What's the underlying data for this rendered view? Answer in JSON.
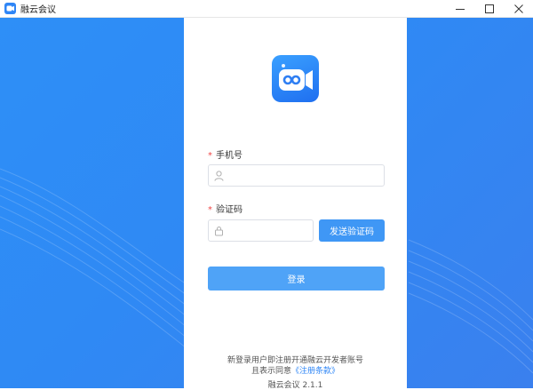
{
  "window": {
    "title": "融云会议",
    "controls": [
      "minimize",
      "maximize",
      "close"
    ]
  },
  "form": {
    "phone_label": "手机号",
    "phone_value": "",
    "phone_placeholder": "",
    "code_label": "验证码",
    "code_value": "",
    "code_placeholder": "",
    "required_mark": "*",
    "send_code_button": "发送验证码",
    "login_button": "登录"
  },
  "footer": {
    "notice_line1": "新登录用户即注册开通融云开发者账号",
    "notice_line2_prefix": "且表示同意",
    "terms_link": "《注册条款》",
    "version": "融云会议 2.1.1"
  },
  "colors": {
    "accent": "#2f86f6",
    "button": "#3f97f5",
    "required": "#f04646"
  },
  "icons": {
    "logo": "video-camera-icon",
    "phone_field": "user-icon",
    "code_field": "lock-icon"
  }
}
